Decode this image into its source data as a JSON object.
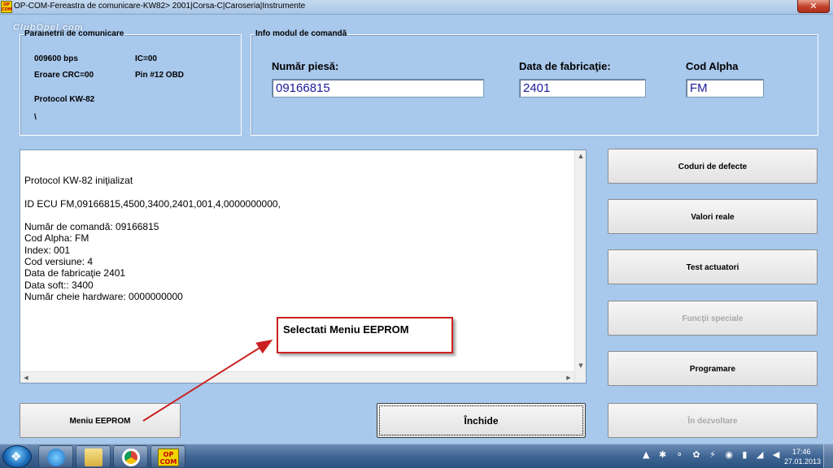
{
  "window": {
    "title": "OP-COM-Fereastra de comunicare-KW82> 2001|Corsa-C|Caroseria|Instrumente",
    "app_icon_text": "OP COM",
    "close_glyph": "✕"
  },
  "watermark": "ClubOpel.com",
  "comm_params": {
    "legend": "Parametrii de comunicare",
    "baud": "009600 bps",
    "ic": "IC=00",
    "crc": "Eroare CRC=00",
    "pin": "Pin #12 OBD",
    "protocol": "Protocol KW-82",
    "extra": "\\"
  },
  "module_info": {
    "legend": "Info modul de comandă",
    "part_label": "Număr piesă:",
    "part_value": "09166815",
    "date_label": "Data de fabricaţie:",
    "date_value": "2401",
    "alpha_label": "Cod Alpha",
    "alpha_value": "FM"
  },
  "log": {
    "lines": [
      "Protocol KW-82 iniţializat",
      "",
      "ID ECU FM,09166815,4500,3400,2401,001,4,0000000000,",
      "",
      "Număr de comandă: 09166815",
      "Cod Alpha: FM",
      "Index: 001",
      "Cod versiune: 4",
      "Data de fabricaţie 2401",
      "Data soft:: 3400",
      "Număr cheie hardware: 0000000000"
    ]
  },
  "buttons": {
    "coduri": "Coduri de defecte",
    "valori": "Valori reale",
    "test": "Test actuatori",
    "functii": "Funcţii speciale",
    "programare": "Programare",
    "dezvoltare": "În dezvoltare",
    "eeprom": "Meniu EEPROM",
    "inchide": "Închide"
  },
  "annotation": {
    "text": "Selectati Meniu EEPROM",
    "color": "#cc2020"
  },
  "taskbar": {
    "opcom_label": "OP COM",
    "tray_icons": "▲ ✱ ⚬ ✿ ⚡ ◉ ▮ ◢ ◀",
    "time": "17:46",
    "date": "27.01.2013"
  }
}
